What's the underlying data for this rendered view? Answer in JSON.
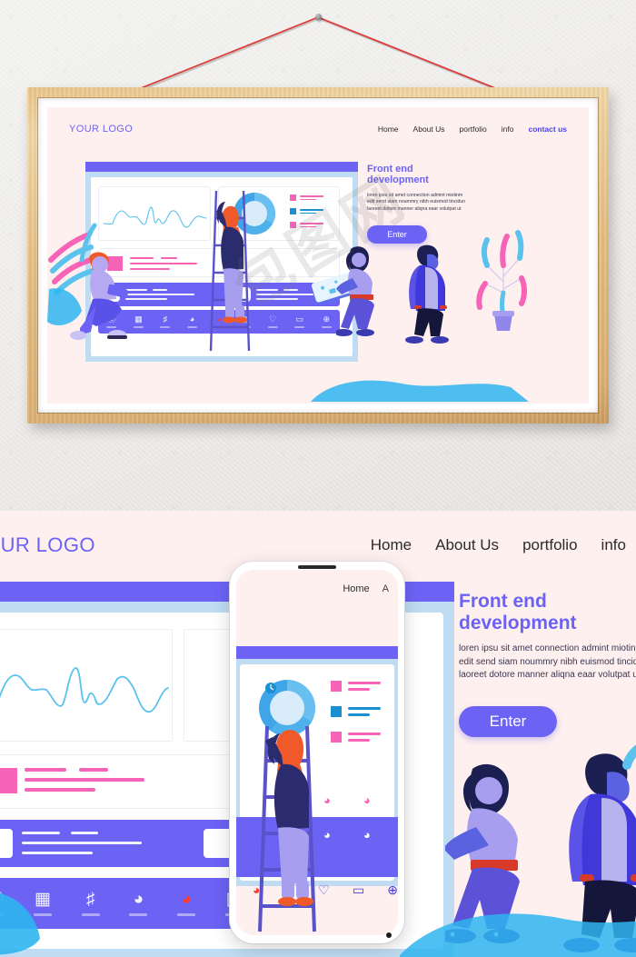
{
  "scene": {
    "description": "Wooden picture frame hanging on a textured grey wall by a red cord from a nail, containing a flat-illustration web landing page mockup; below is a large zoomed crop of the same design with a phone mockup overlaid.",
    "watermark": "包图网"
  },
  "colors": {
    "wall": "#eceae8",
    "frame_wood": "#e2bc80",
    "mat": "#ffffff",
    "page_background": "#fdf0ee",
    "primary_purple": "#6c63f5",
    "accent_link": "#4a3ff0",
    "light_blue": "#bfdcf2",
    "chart_blue": "#5bc2ee",
    "pink": "#f763b6",
    "red_wifi": "#ff3b30",
    "string_red": "#e03a3a"
  },
  "site": {
    "logo": "YOUR LOGO",
    "nav": [
      {
        "label": "Home",
        "accent": false
      },
      {
        "label": "About Us",
        "accent": false
      },
      {
        "label": "portfolio",
        "accent": false
      },
      {
        "label": "info",
        "accent": false
      },
      {
        "label": "contact us",
        "accent": true
      }
    ],
    "hero": {
      "headline_line1": "Front end",
      "headline_line2": "development",
      "body_line1": "loren ipsu  sit amet connection admint miotinm",
      "body_line2": "edit send siam noummry nibh euismod tincidun",
      "body_line3": "laoreet dotore manner aliqna eaar volutpat ut",
      "cta_label": "Enter"
    },
    "dashboard": {
      "line_chart_label": "line-chart",
      "donut_chart_label": "donut-chart",
      "legend": [
        {
          "swatch": "#f763b6"
        },
        {
          "swatch": "#1a8fd1"
        },
        {
          "swatch": "#f763b6"
        }
      ]
    },
    "icon_bar": [
      {
        "name": "yen-currency-icon",
        "glyph": "¥",
        "red": false
      },
      {
        "name": "news-document-icon",
        "glyph": "▤",
        "red": false
      },
      {
        "name": "gift-icon",
        "glyph": "🎁",
        "red": false
      },
      {
        "name": "headphones-icon",
        "glyph": "⌒",
        "red": false
      },
      {
        "name": "wifi-icon",
        "glyph": "≋",
        "red": true
      },
      {
        "name": "camera-icon",
        "glyph": "▣",
        "red": false
      },
      {
        "name": "heart-icon",
        "glyph": "♡",
        "red": false
      },
      {
        "name": "monitor-icon",
        "glyph": "▭",
        "red": false
      },
      {
        "name": "globe-icon",
        "glyph": "⊕",
        "red": false
      }
    ]
  },
  "phone": {
    "nav_label": "Home",
    "nav_label_partial": "A"
  }
}
